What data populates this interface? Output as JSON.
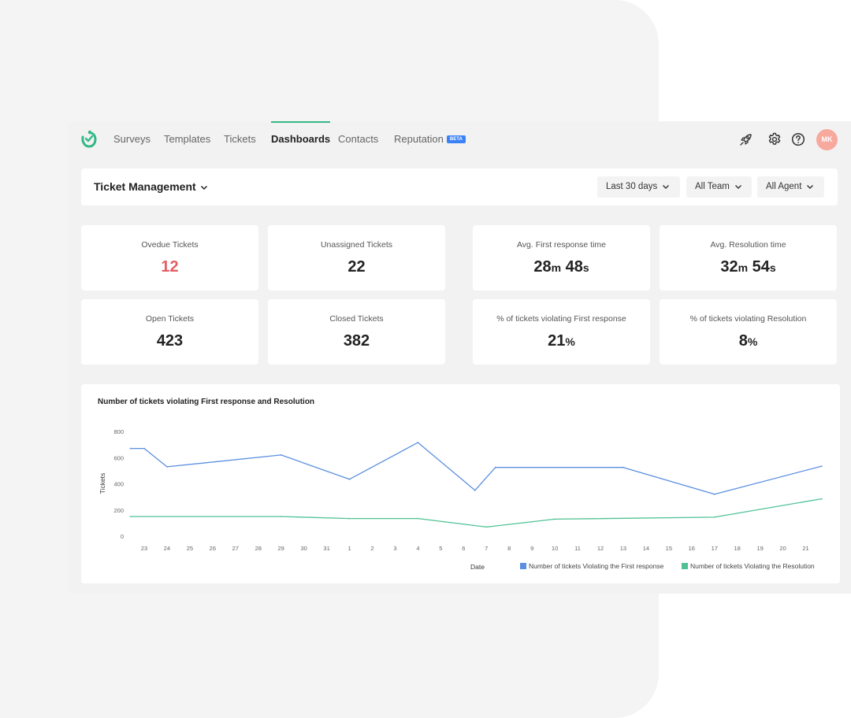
{
  "nav": {
    "items": [
      {
        "label": "Surveys",
        "name": "nav-surveys",
        "active": false
      },
      {
        "label": "Templates",
        "name": "nav-templates",
        "active": false
      },
      {
        "label": "Tickets",
        "name": "nav-tickets",
        "active": false
      },
      {
        "label": "Dashboards",
        "name": "nav-dashboards",
        "active": true
      },
      {
        "label": "Contacts",
        "name": "nav-contacts",
        "active": false
      },
      {
        "label": "Reputation",
        "name": "nav-reputation",
        "active": false,
        "badge": "BETA"
      }
    ],
    "avatar_initials": "MK",
    "icons": [
      "rocket-icon",
      "gear-icon",
      "help-icon"
    ]
  },
  "header": {
    "title": "Ticket Management",
    "filters": [
      "Last 30 days",
      "All Team",
      "All Agent"
    ]
  },
  "metrics": {
    "overdue": {
      "label": "Ovedue Tickets",
      "value": "12"
    },
    "unassigned": {
      "label": "Unassigned Tickets",
      "value": "22"
    },
    "avg_first_response": {
      "label": "Avg. First response time",
      "v1": "28",
      "u1": "m",
      "v2": "48",
      "u2": "s"
    },
    "avg_resolution": {
      "label": "Avg. Resolution time",
      "v1": "32",
      "u1": "m",
      "v2": "54",
      "u2": "s"
    },
    "open": {
      "label": "Open Tickets",
      "value": "423"
    },
    "closed": {
      "label": "Closed Tickets",
      "value": "382"
    },
    "pct_first_response": {
      "label": "% of tickets violating First response",
      "value": "21",
      "unit": "%"
    },
    "pct_resolution": {
      "label": "% of tickets violating Resolution",
      "value": "8",
      "unit": "%"
    }
  },
  "colors": {
    "accent": "#34b887",
    "series1": "#5b8fe0",
    "series2": "#4fc295",
    "red_value": "#e35d63",
    "avatar": "#f7a99d",
    "beta": "#3b82f6"
  },
  "chart_data": {
    "type": "line",
    "title": "Number of tickets violating First response and Resolution",
    "xlabel": "Date",
    "ylabel": "Tickets",
    "categories": [
      "23",
      "24",
      "25",
      "26",
      "27",
      "28",
      "29",
      "30",
      "31",
      "1",
      "2",
      "3",
      "4",
      "5",
      "6",
      "7",
      "8",
      "9",
      "10",
      "11",
      "12",
      "13",
      "14",
      "15",
      "16",
      "17",
      "18",
      "19",
      "20",
      "21"
    ],
    "yticks": [
      0,
      200,
      400,
      600,
      800
    ],
    "ylim": [
      0,
      800
    ],
    "grid": false,
    "legend_position": "bottom-right",
    "series": [
      {
        "name": "Number of tickets Violating the First response",
        "color": "#5b8fe0",
        "points": [
          [
            -0.6,
            670
          ],
          [
            0.0,
            670
          ],
          [
            1.0,
            530
          ],
          [
            6.0,
            620
          ],
          [
            9.0,
            435
          ],
          [
            12.0,
            715
          ],
          [
            14.5,
            350
          ],
          [
            15.4,
            525
          ],
          [
            21.0,
            525
          ],
          [
            25.0,
            320
          ],
          [
            29.7,
            535
          ]
        ]
      },
      {
        "name": "Number of tickets Violating the Resolution",
        "color": "#4fc295",
        "points": [
          [
            -0.6,
            150
          ],
          [
            6.0,
            150
          ],
          [
            9.0,
            135
          ],
          [
            12.0,
            135
          ],
          [
            15.0,
            70
          ],
          [
            18.0,
            130
          ],
          [
            25.0,
            145
          ],
          [
            29.7,
            285
          ]
        ]
      }
    ]
  }
}
